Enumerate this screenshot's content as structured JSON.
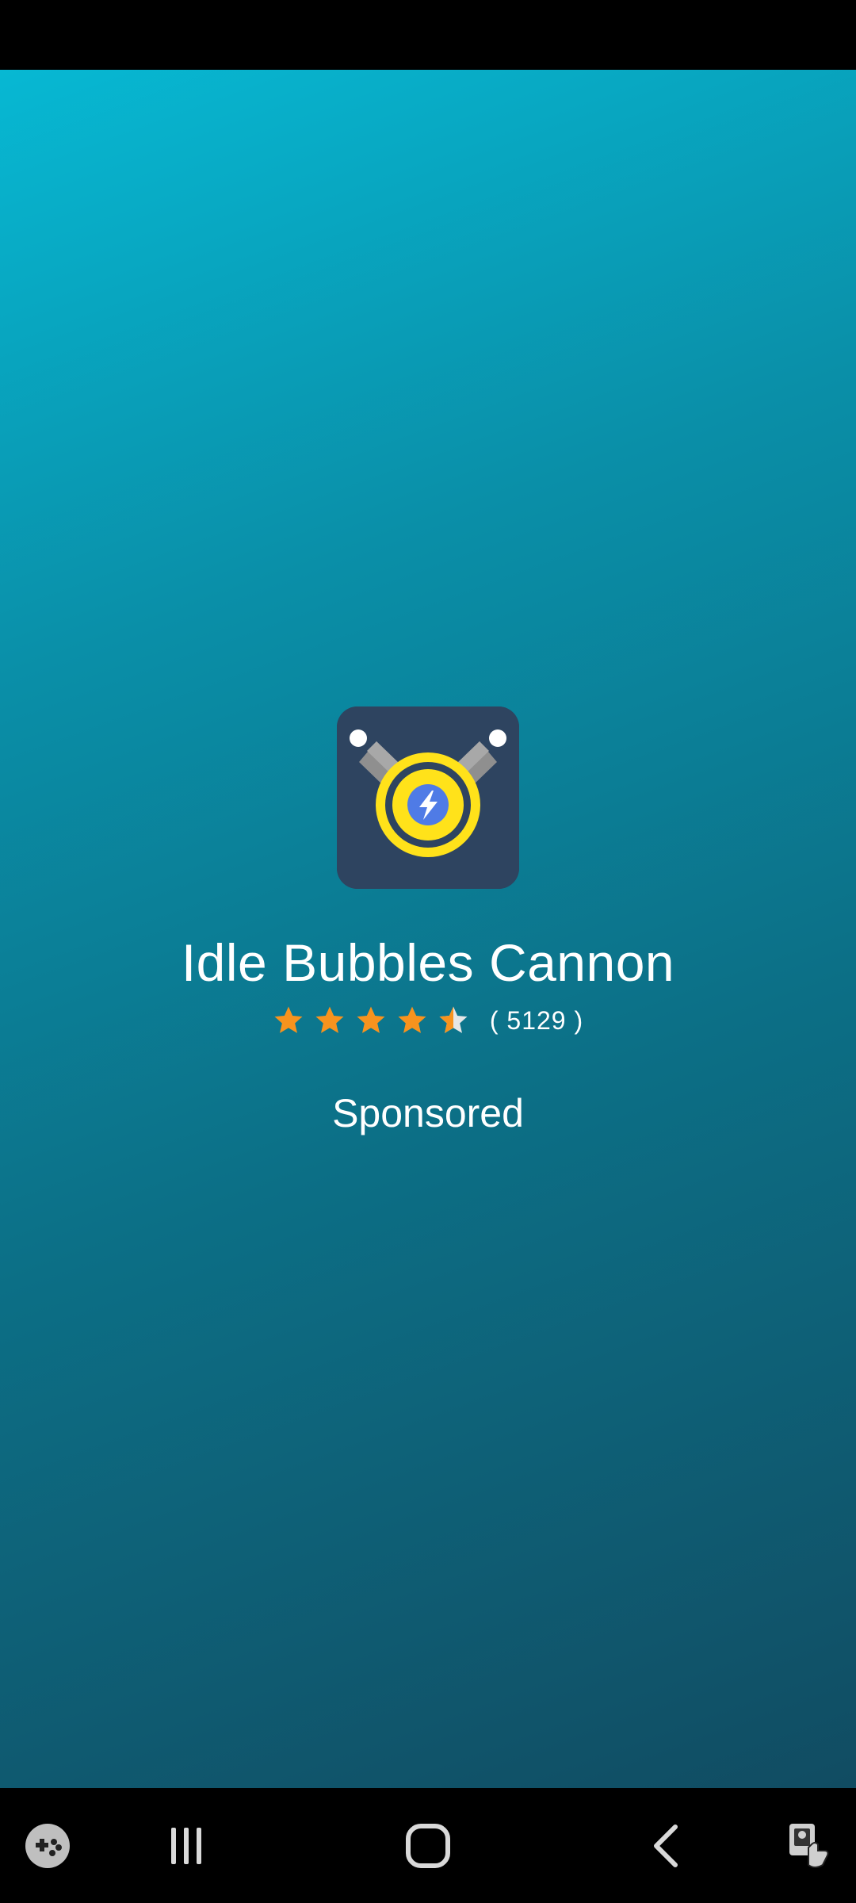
{
  "ad": {
    "app_name": "Idle Bubbles Cannon",
    "rating": 4.5,
    "rating_max": 5,
    "rating_count": "( 5129 )",
    "sponsored_label": "Sponsored",
    "icon": "cannon-app-icon"
  },
  "colors": {
    "background_top": "#07b8d3",
    "background_bottom": "#114c62",
    "star_fill": "#f7931e",
    "star_empty": "#e6e6e6",
    "icon_bg": "#2e4460",
    "icon_ring": "#ffe21a",
    "icon_core": "#4f7be6"
  },
  "nav_bar": {
    "items": [
      "game-launcher-icon",
      "recent-apps-icon",
      "home-icon",
      "back-icon",
      "screen-touch-icon"
    ]
  }
}
